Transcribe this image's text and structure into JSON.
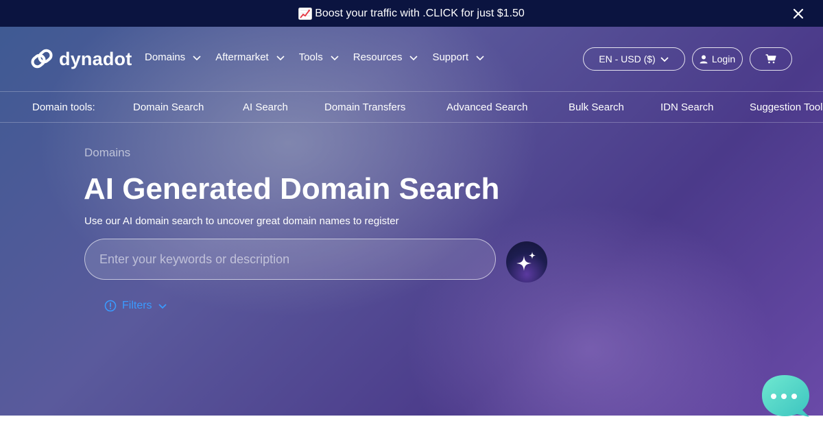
{
  "promo": {
    "text": "Boost your traffic with .CLICK for just $1.50",
    "icon": "chart-increasing-icon"
  },
  "brand": {
    "name": "dynadot"
  },
  "nav": {
    "items": [
      {
        "label": "Domains"
      },
      {
        "label": "Aftermarket"
      },
      {
        "label": "Tools"
      },
      {
        "label": "Resources"
      },
      {
        "label": "Support"
      }
    ],
    "language_currency": "EN - USD ($)",
    "login": "Login"
  },
  "tools_bar": {
    "label": "Domain tools:",
    "items": [
      {
        "label": "Domain Search"
      },
      {
        "label": "AI Search"
      },
      {
        "label": "Domain Transfers"
      },
      {
        "label": "Advanced Search"
      },
      {
        "label": "Bulk Search"
      },
      {
        "label": "IDN Search"
      },
      {
        "label": "Suggestion Tool"
      }
    ]
  },
  "hero": {
    "breadcrumb": "Domains",
    "title": "AI Generated Domain Search",
    "subtitle": "Use our AI domain search to uncover great domain names to register",
    "search_placeholder": "Enter your keywords or description",
    "filters_label": "Filters"
  },
  "colors": {
    "promo_bg": "#0b1440",
    "accent_link": "#3a9bff",
    "chat_bubble": "#4fd8c4"
  }
}
